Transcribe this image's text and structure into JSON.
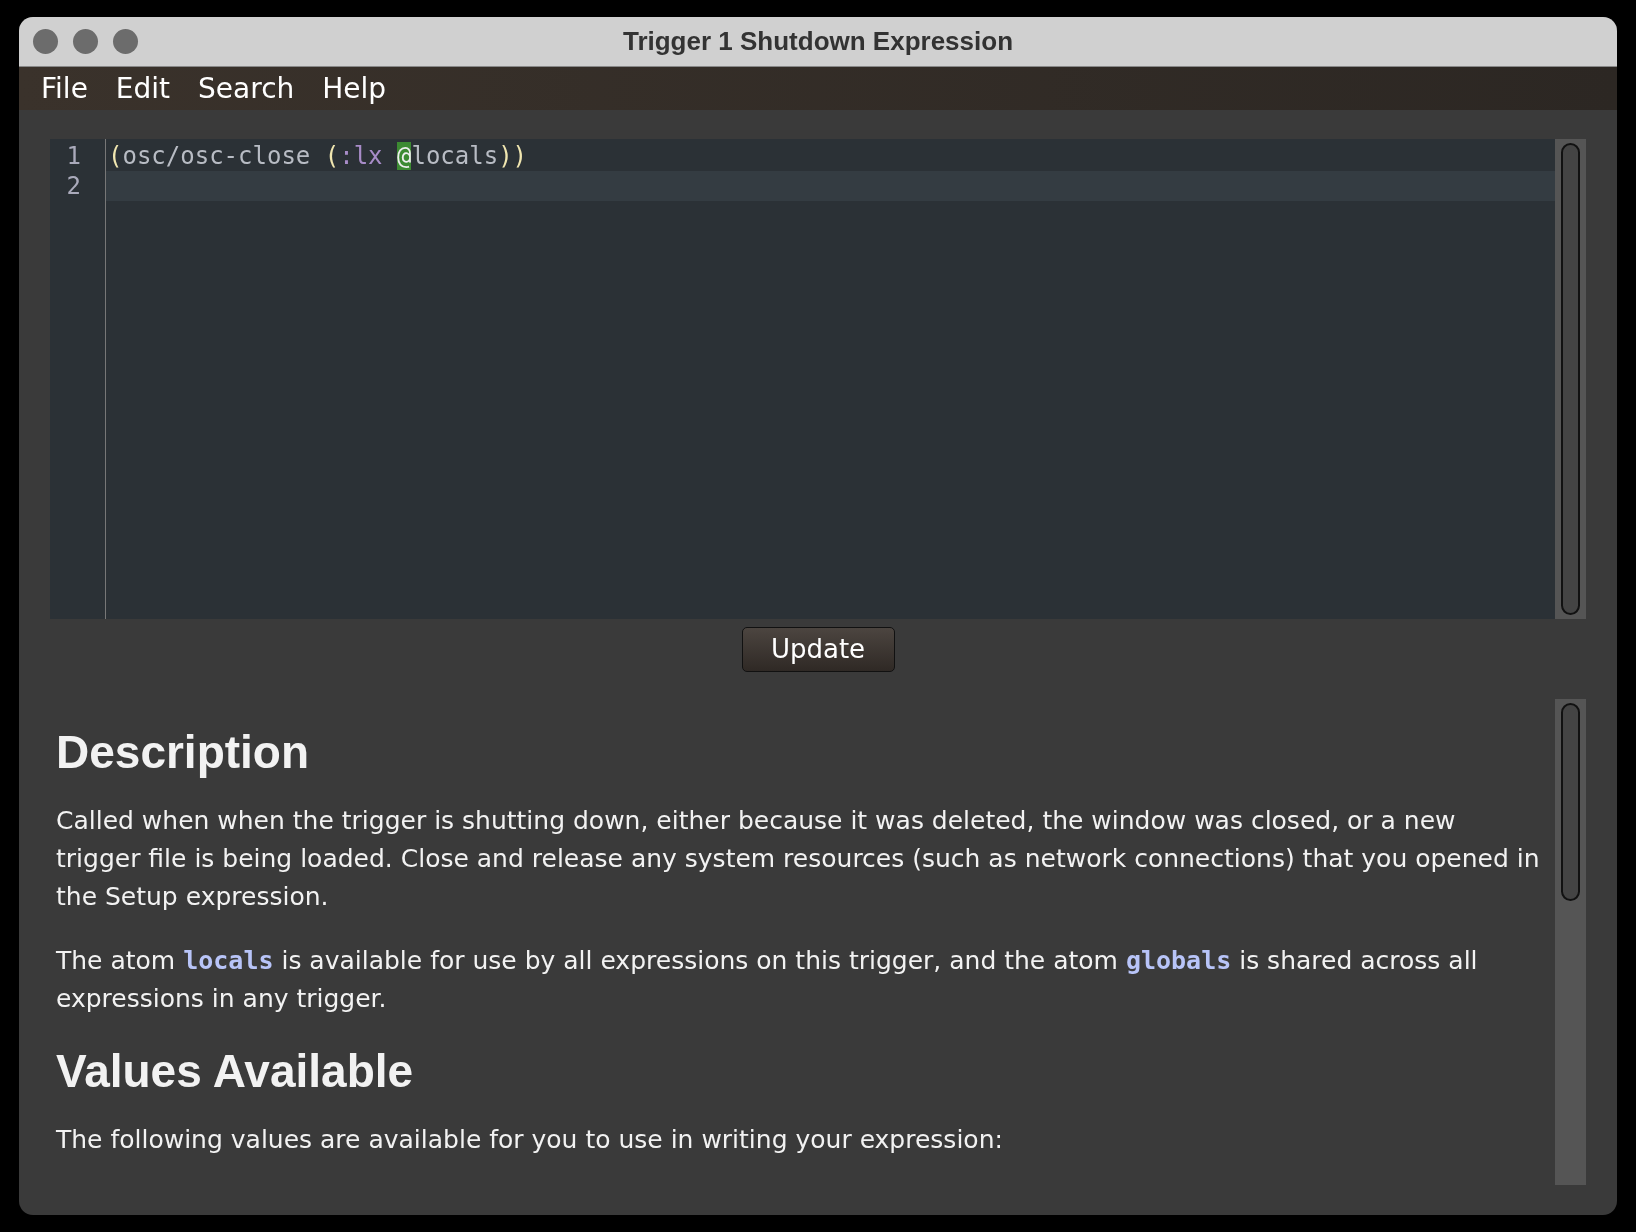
{
  "window": {
    "title": "Trigger 1 Shutdown Expression"
  },
  "menu": [
    "File",
    "Edit",
    "Search",
    "Help"
  ],
  "editor": {
    "lines": [
      {
        "number": "1",
        "current": false,
        "tokens": [
          {
            "kind": "paren",
            "text": "("
          },
          {
            "kind": "symbol",
            "text": "osc/osc-close "
          },
          {
            "kind": "paren",
            "text": "("
          },
          {
            "kind": "keyword",
            "text": ":lx "
          },
          {
            "kind": "match",
            "text": "@"
          },
          {
            "kind": "symbol",
            "text": "locals"
          },
          {
            "kind": "paren",
            "text": "))"
          }
        ]
      },
      {
        "number": "2",
        "current": true
      }
    ]
  },
  "update_button": "Update",
  "documentation": [
    {
      "kind": "heading",
      "text": "Description"
    },
    {
      "kind": "paragraph",
      "text": "Called when when the trigger is shutting down, either because it was deleted, the window was closed, or a new trigger file is being loaded. Close and release any system resources (such as network connections) that you opened in the Setup expression."
    },
    {
      "kind": "paragraph",
      "text": "The atom **locals** is available for use by all expressions on this trigger, and the atom **globals** is shared across all expressions in any trigger."
    },
    {
      "kind": "heading",
      "text": "Values Available"
    },
    {
      "kind": "paragraph",
      "text": "The following values are available for you to use in writing your expression:"
    }
  ]
}
